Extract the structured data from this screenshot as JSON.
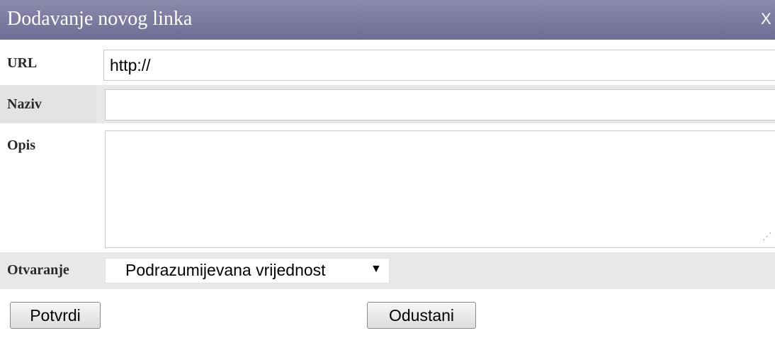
{
  "dialog": {
    "title": "Dodavanje novog linka",
    "close_label": "X"
  },
  "form": {
    "url": {
      "label": "URL",
      "value": "http://"
    },
    "naziv": {
      "label": "Naziv",
      "value": ""
    },
    "opis": {
      "label": "Opis",
      "value": ""
    },
    "otvaranje": {
      "label": "Otvaranje",
      "selected": "Podrazumijevana vrijednost"
    }
  },
  "buttons": {
    "confirm": "Potvrdi",
    "cancel": "Odustani"
  },
  "colors": {
    "titlebar": "#7c7a9f",
    "row_shade": "#e6e8ea"
  }
}
